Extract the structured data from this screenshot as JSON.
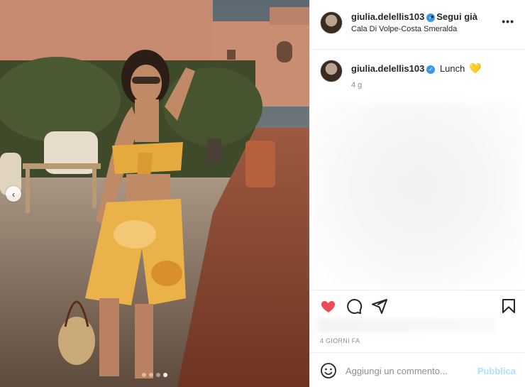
{
  "post": {
    "username": "giulia.delellis103",
    "follow_separator": "•",
    "follow_label": "Segui già",
    "location": "Cala Di Volpe-Costa Smeralda",
    "more_label": "•••",
    "verified_glyph": "✓"
  },
  "caption": {
    "username": "giulia.delellis103",
    "text": "Lunch",
    "emoji": "💛",
    "time": "4 g"
  },
  "carousel": {
    "prev_glyph": "‹",
    "slide_count": 4,
    "active_index": 3
  },
  "actions": {
    "liked": true,
    "like_color": "#ed4956",
    "icons": [
      "heart-filled-icon",
      "comment-icon",
      "share-icon",
      "bookmark-icon"
    ]
  },
  "date_label": "4 GIORNI FA",
  "comment": {
    "placeholder": "Aggiungi un commento...",
    "publish_label": "Pubblica",
    "publish_color": "#b2dffc"
  }
}
